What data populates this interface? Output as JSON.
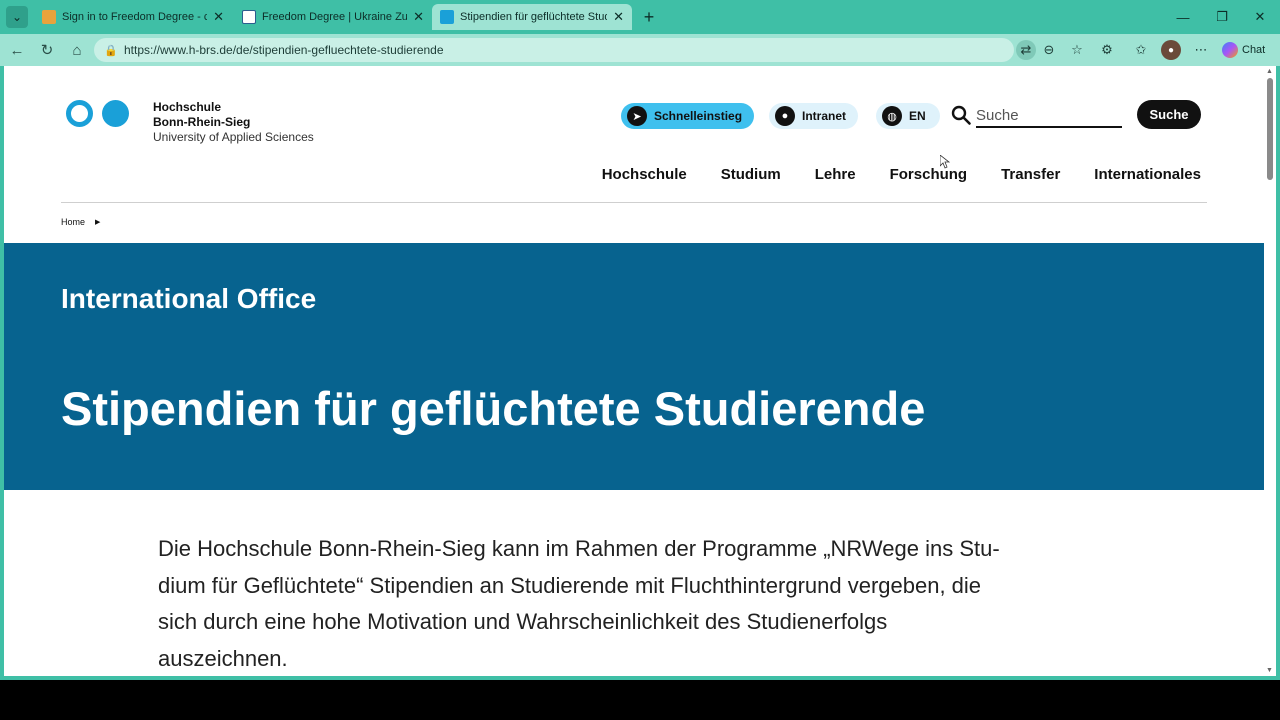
{
  "browser": {
    "tabs": [
      {
        "title": "Sign in to Freedom Degree - cmsc",
        "active": false,
        "favicon_color": "#e8a33c"
      },
      {
        "title": "Freedom Degree | Ukraine Zukunft",
        "active": false,
        "favicon_color": "#ffffff"
      },
      {
        "title": "Stipendien für geflüchtete Studiere",
        "active": true,
        "favicon_color": "#1aa0d8"
      }
    ],
    "url": "https://www.h-brs.de/de/stipendien-gefluechtete-studierende",
    "chat_label": "Chat"
  },
  "site": {
    "logo": {
      "line1": "Hochschule",
      "line2": "Bonn-Rhein-Sieg",
      "line3": "University of Applied Sciences",
      "color": "#1aa0d8"
    },
    "quicklinks": {
      "schnelleinstieg": "Schnelleinstieg",
      "intranet": "Intranet",
      "language": "EN"
    },
    "search": {
      "placeholder": "Suche",
      "button": "Suche"
    },
    "nav": [
      "Hochschule",
      "Studium",
      "Lehre",
      "Forschung",
      "Transfer",
      "Internationales"
    ],
    "breadcrumb": {
      "home": "Home"
    },
    "banner": {
      "kicker": "International Office",
      "title": "Stipendien für geflüchtete Studierende",
      "color": "#07638f"
    },
    "intro_lines": [
      "Die Hochschule Bonn-Rhein-Sieg kann im Rahmen der Programme „NRWege ins Stu-",
      "dium für Geflüchtete“ Stipendien an Studierende mit Fluchthintergrund vergeben, die",
      "sich durch eine hohe Motivation und Wahrscheinlichkeit des Studienerfolgs",
      "auszeichnen."
    ]
  }
}
